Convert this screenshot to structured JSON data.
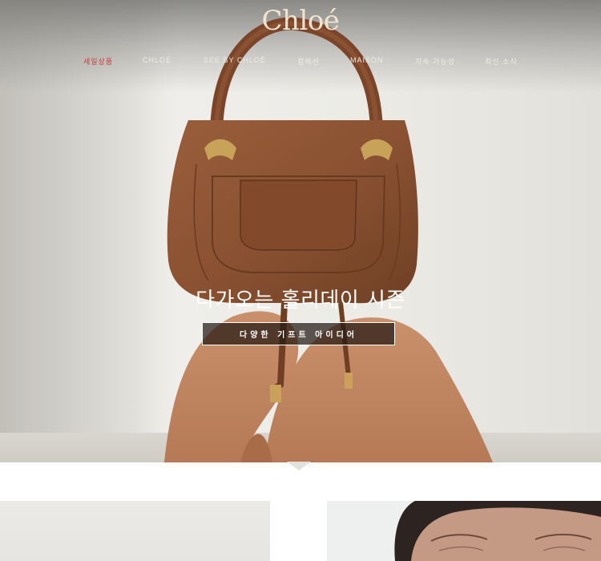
{
  "brand": {
    "logo_text": "Chloé"
  },
  "nav": {
    "items": [
      {
        "label": "세일상품",
        "highlight": true
      },
      {
        "label": "CHLOÉ"
      },
      {
        "label": "SEE BY CHLOÉ"
      },
      {
        "label": "컬렉션"
      },
      {
        "label": "MAISON"
      },
      {
        "label": "지속 가능성"
      },
      {
        "label": "최신 소식"
      }
    ]
  },
  "hero": {
    "headline": "다가오는 홀리데이 시즌",
    "cta_label": "다양한 기프트 아이디어",
    "image": "model-holding-brown-leather-handbag"
  },
  "tiles": [
    {
      "image": "gray-background-product"
    },
    {
      "image": "model-face-closeup"
    }
  ],
  "colors": {
    "logo": "#f1e3cf",
    "nav_text": "#f1ece4",
    "nav_sale": "#c8403e",
    "cta_bg": "#2b201a",
    "bag_leather": "#8a5232"
  }
}
